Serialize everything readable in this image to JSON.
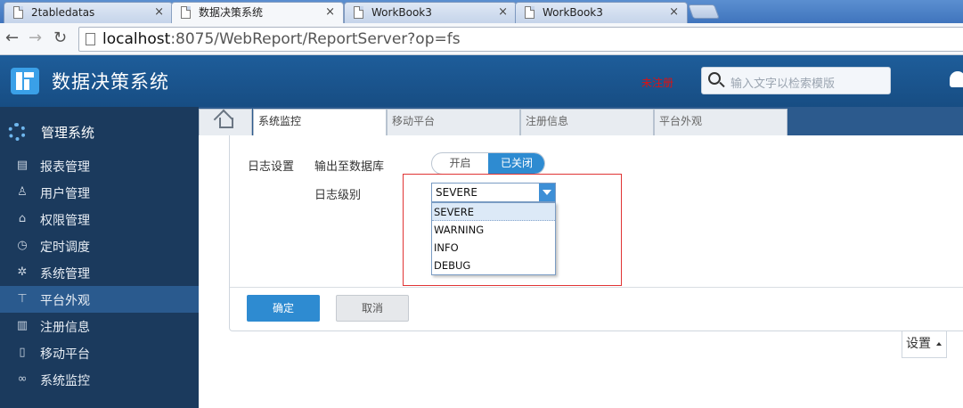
{
  "browser": {
    "tabs": [
      {
        "label": "2tabledatas",
        "active": false
      },
      {
        "label": "数据决策系统",
        "active": true
      },
      {
        "label": "WorkBook3",
        "active": false
      },
      {
        "label": "WorkBook3",
        "active": false
      }
    ],
    "close_glyph": "×",
    "url_host": "localhost",
    "url_rest": ":8075/WebReport/ReportServer?op=fs"
  },
  "header": {
    "title": "数据决策系统",
    "unregistered": "未注册",
    "search_placeholder": "输入文字以检索模版"
  },
  "sidebar": {
    "heading": "管理系统",
    "items": [
      {
        "label": "报表管理",
        "icon": "report-icon"
      },
      {
        "label": "用户管理",
        "icon": "user-icon"
      },
      {
        "label": "权限管理",
        "icon": "permission-icon"
      },
      {
        "label": "定时调度",
        "icon": "clock-icon"
      },
      {
        "label": "系统管理",
        "icon": "gear-icon"
      },
      {
        "label": "平台外观",
        "icon": "paint-roller-icon"
      },
      {
        "label": "注册信息",
        "icon": "registration-icon"
      },
      {
        "label": "移动平台",
        "icon": "mobile-icon"
      },
      {
        "label": "系统监控",
        "icon": "binoculars-icon"
      }
    ],
    "active_index": 5
  },
  "module_tabs": [
    {
      "label": "系统监控",
      "active": true
    },
    {
      "label": "移动平台",
      "active": false
    },
    {
      "label": "注册信息",
      "active": false
    },
    {
      "label": "平台外观",
      "active": false
    }
  ],
  "form": {
    "log_settings_label": "日志设置",
    "output_db_label": "输出至数据库",
    "toggle_on": "开启",
    "toggle_off": "已关闭",
    "log_level_label": "日志级别",
    "log_level_value": "SEVERE",
    "log_level_options": [
      "SEVERE",
      "WARNING",
      "INFO",
      "DEBUG"
    ],
    "ok": "确定",
    "cancel": "取消",
    "settings": "设置"
  },
  "colors": {
    "header_bg": "#1e5d9a",
    "sidebar_bg": "#1b3a5d",
    "accent": "#2e8bd1",
    "unregistered_red": "#e01010"
  }
}
